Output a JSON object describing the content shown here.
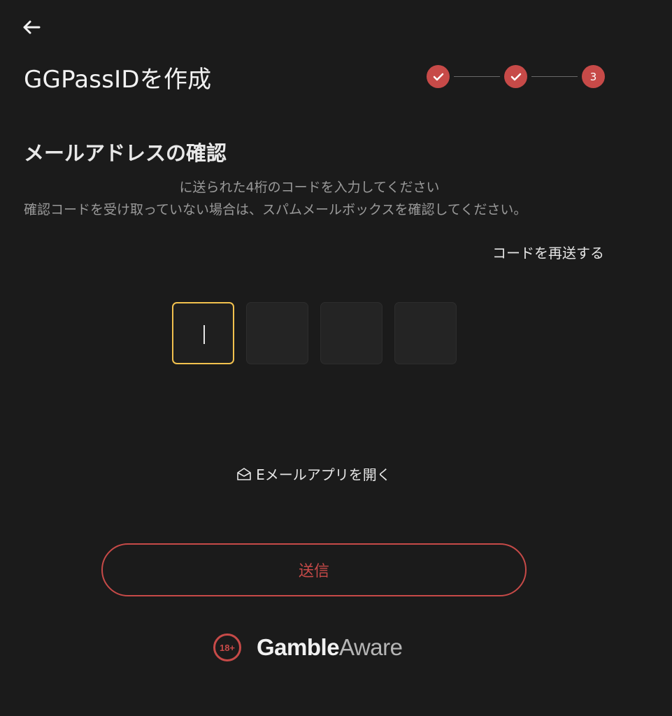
{
  "header": {
    "title": "GGPassIDを作成"
  },
  "stepper": {
    "steps": [
      {
        "label": "",
        "state": "done"
      },
      {
        "label": "",
        "state": "done"
      },
      {
        "label": "3",
        "state": "current"
      }
    ],
    "accent": "#c74a48"
  },
  "section": {
    "title": "メールアドレスの確認",
    "instruction": "に送られた4桁のコードを入力してください",
    "hint": "確認コードを受け取っていない場合は、スパムメールボックスを確認してください。"
  },
  "resend_label": "コードを再送する",
  "code": {
    "length": 4,
    "digits": [
      "",
      "",
      "",
      ""
    ],
    "active_index": 0,
    "active_color": "#f2c14e"
  },
  "mail_app": {
    "icon": "envelope-open-icon",
    "label": "Eメールアプリを開く"
  },
  "submit_label": "送信",
  "footer": {
    "age_badge": "18+",
    "brand_part1": "Gamble",
    "brand_part2": "Aware"
  }
}
